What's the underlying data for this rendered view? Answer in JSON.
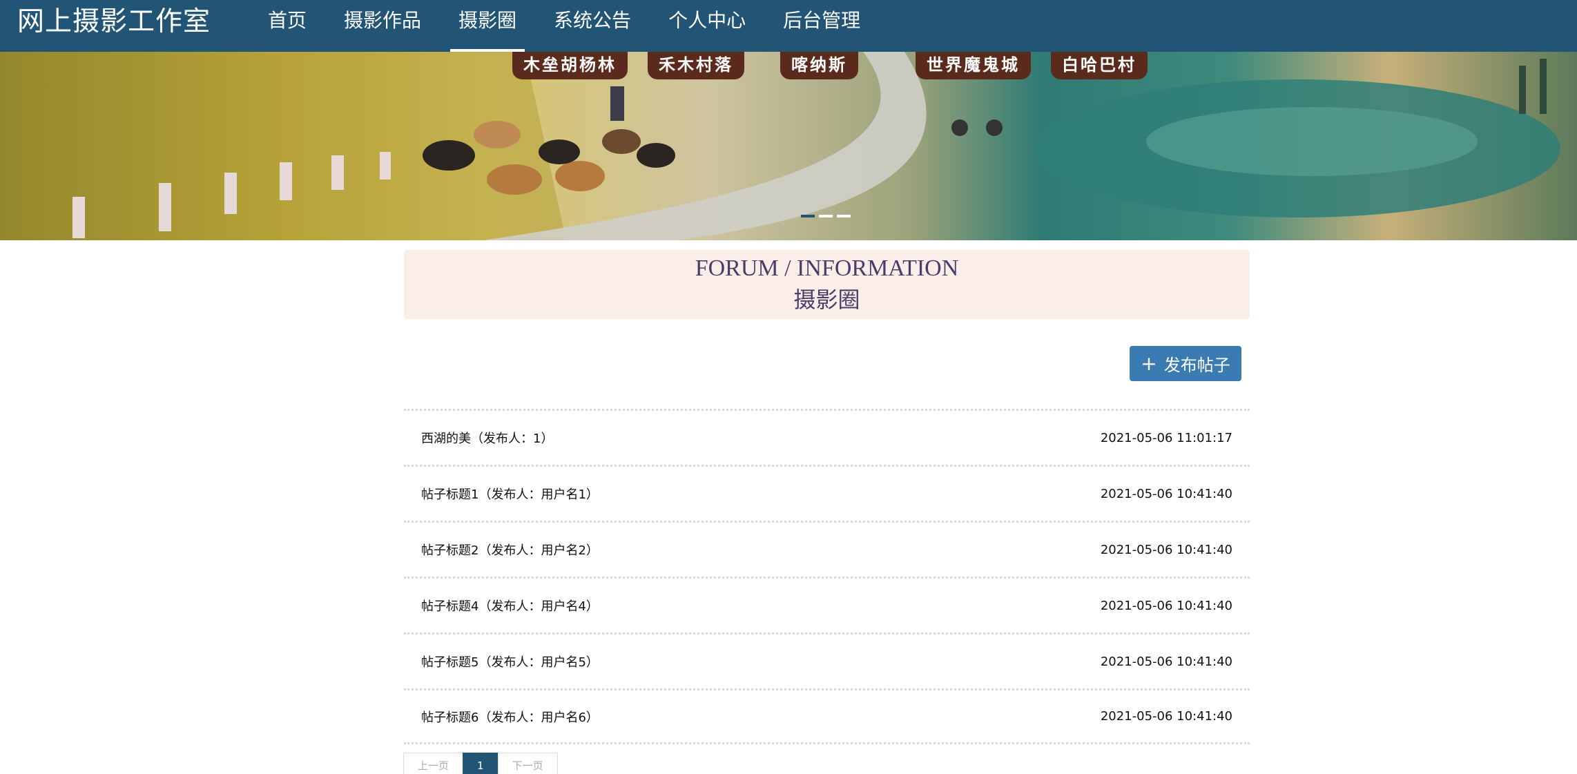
{
  "header": {
    "brand": "网上摄影工作室",
    "nav": [
      {
        "label": "首页",
        "active": false
      },
      {
        "label": "摄影作品",
        "active": false
      },
      {
        "label": "摄影圈",
        "active": true
      },
      {
        "label": "系统公告",
        "active": false
      },
      {
        "label": "个人中心",
        "active": false
      },
      {
        "label": "后台管理",
        "active": false
      }
    ]
  },
  "banner": {
    "tabs": [
      "木垒胡杨林",
      "禾木村落",
      "喀纳斯",
      "世界魔鬼城",
      "白哈巴村"
    ],
    "slides": 3,
    "active_slide": 1
  },
  "section": {
    "title_en": "FORUM / INFORMATION",
    "title_cn": "摄影圈"
  },
  "actions": {
    "publish_label": "发布帖子"
  },
  "posts": [
    {
      "title": "西湖的美（发布人：1）",
      "time": "2021-05-06 11:01:17"
    },
    {
      "title": "帖子标题1（发布人：用户名1）",
      "time": "2021-05-06 10:41:40"
    },
    {
      "title": "帖子标题2（发布人：用户名2）",
      "time": "2021-05-06 10:41:40"
    },
    {
      "title": "帖子标题4（发布人：用户名4）",
      "time": "2021-05-06 10:41:40"
    },
    {
      "title": "帖子标题5（发布人：用户名5）",
      "time": "2021-05-06 10:41:40"
    },
    {
      "title": "帖子标题6（发布人：用户名6）",
      "time": "2021-05-06 10:41:40"
    }
  ],
  "pagination": {
    "prev": "上一页",
    "current": "1",
    "next": "下一页"
  },
  "colors": {
    "header_bg": "#215475",
    "title_bg": "#fbeee9",
    "button_bg": "#3a7bb2"
  }
}
